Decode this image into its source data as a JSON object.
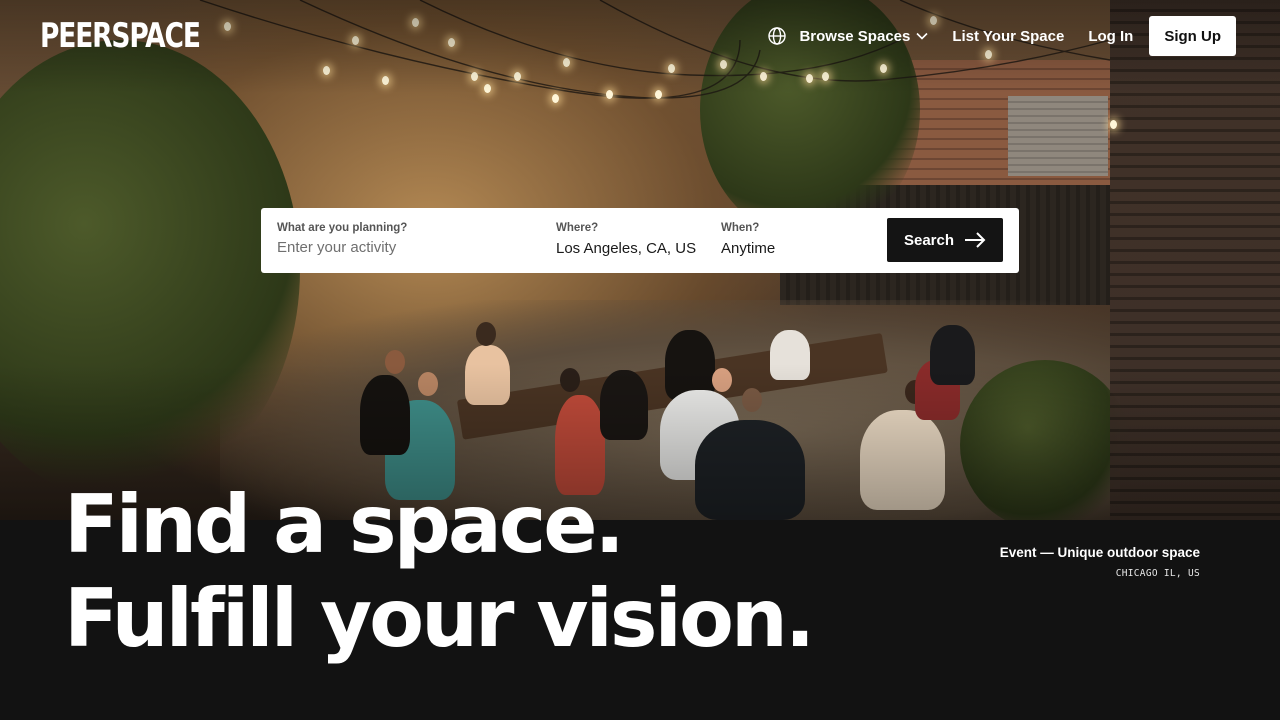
{
  "brand": {
    "logo_text": "PEERSPACE"
  },
  "nav": {
    "globe_icon": "globe-icon",
    "browse_label": "Browse Spaces",
    "list_label": "List Your Space",
    "login_label": "Log In",
    "signup_label": "Sign Up"
  },
  "search": {
    "activity": {
      "label": "What are you planning?",
      "placeholder": "Enter your activity",
      "value": ""
    },
    "where": {
      "label": "Where?",
      "value": "Los Angeles, CA, US"
    },
    "when": {
      "label": "When?",
      "value": "Anytime"
    },
    "button_label": "Search",
    "button_icon": "arrow-right-icon"
  },
  "hero": {
    "headline_line1": "Find a space.",
    "headline_line2": "Fulfill your vision.",
    "caption_title": "Event — Unique outdoor space",
    "caption_location": "CHICAGO IL, US"
  },
  "colors": {
    "background": "#121212",
    "button_dark": "#141414",
    "text_light": "#ffffff"
  }
}
